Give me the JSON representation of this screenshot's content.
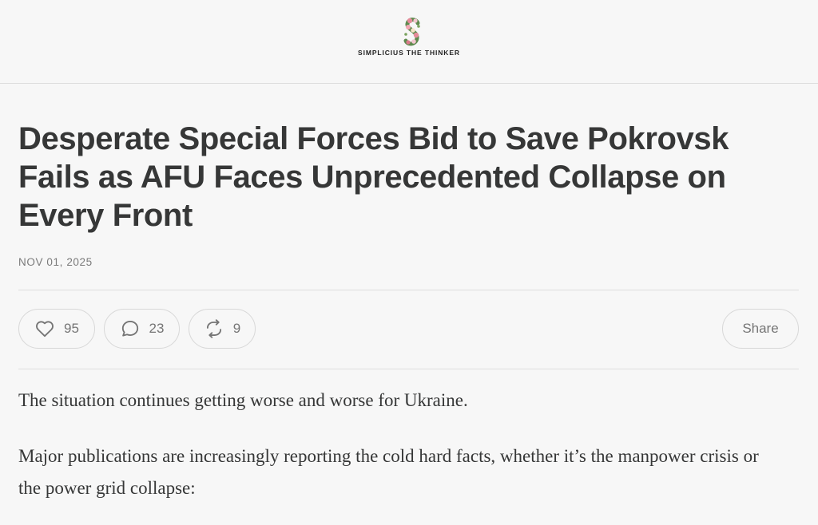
{
  "header": {
    "publication": "SIMPLICIUS THE THINKER",
    "logo_icon": "floral-s-logo-icon"
  },
  "article": {
    "title": "Desperate Special Forces Bid to Save Pokrovsk Fails as AFU Faces Unprecedented Collapse on Every Front",
    "date": "NOV 01, 2025",
    "paragraphs": [
      "The situation continues getting worse and worse for Ukraine.",
      "Major publications are increasingly reporting the cold hard facts, whether it’s the manpower crisis or the power grid collapse:"
    ]
  },
  "actions": {
    "likes": "95",
    "comments": "23",
    "restacks": "9",
    "share_label": "Share",
    "icons": {
      "like": "heart-icon",
      "comment": "comment-bubble-icon",
      "restack": "restack-icon"
    }
  },
  "colors": {
    "background": "#f7f7f7",
    "text": "#363737",
    "muted": "#757575",
    "border": "#d8d8d8"
  }
}
